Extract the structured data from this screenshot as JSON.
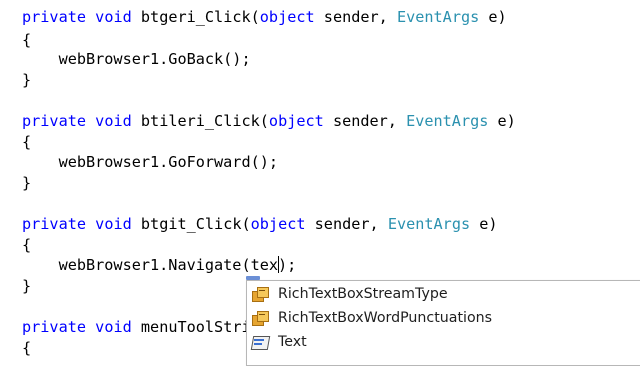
{
  "code": {
    "line1": {
      "kw1": "private",
      "kw2": "void",
      "name": "btgeri_Click(",
      "ptype": "object",
      "mid": " sender, ",
      "etype": "EventArgs",
      "end": " e)"
    },
    "line2": "{",
    "line3": "    webBrowser1.GoBack();",
    "line4": "}",
    "line5": {
      "kw1": "private",
      "kw2": "void",
      "name": "btileri_Click(",
      "ptype": "object",
      "mid": " sender, ",
      "etype": "EventArgs",
      "end": " e)"
    },
    "line6": "{",
    "line7": "    webBrowser1.GoForward();",
    "line8": "}",
    "line9": {
      "kw1": "private",
      "kw2": "void",
      "name": "btgit_Click(",
      "ptype": "object",
      "mid": " sender, ",
      "etype": "EventArgs",
      "end": " e)"
    },
    "line10": "{",
    "line11_before": "    webBrowser1.Navigate(tex",
    "line11_after": ");",
    "line12": "}",
    "line13": {
      "kw1": "private",
      "kw2": "void",
      "name": "menuToolStri"
    },
    "line14": "{"
  },
  "intellisense": {
    "items": [
      {
        "label": "RichTextBoxStreamType",
        "icon": "enum-icon"
      },
      {
        "label": "RichTextBoxWordPunctuations",
        "icon": "enum-icon"
      },
      {
        "label": "Text",
        "icon": "property-icon"
      }
    ]
  }
}
